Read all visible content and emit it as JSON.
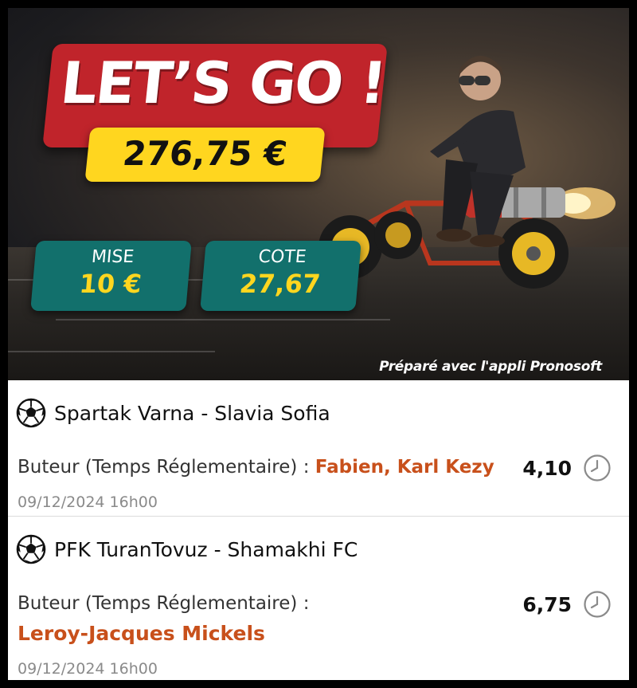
{
  "banner": {
    "title": "LET’S GO !",
    "potential_win": "276,75 €",
    "stake_label": "MISE",
    "stake_value": "10 €",
    "odds_label": "COTE",
    "odds_value": "27,67",
    "footer": "Préparé avec l'appli Pronosoft"
  },
  "bets": [
    {
      "match": "Spartak Varna - Slavia Sofia",
      "market": "Buteur (Temps Réglementaire) :",
      "selection": "Fabien, Karl Kezy",
      "odds": "4,10",
      "date": "09/12/2024 16h00",
      "icon": "soccer-ball-icon",
      "status_icon": "clock-icon"
    },
    {
      "match": "PFK TuranTovuz - Shamakhi FC",
      "market": "Buteur (Temps Réglementaire) :",
      "selection": "Leroy-Jacques Mickels",
      "odds": "6,75",
      "date": "09/12/2024 16h00",
      "icon": "soccer-ball-icon",
      "status_icon": "clock-icon"
    }
  ],
  "colors": {
    "title_red": "#c0242b",
    "amount_yellow": "#ffd61f",
    "stat_teal": "#12706c",
    "selection_orange": "#c8501b",
    "date_gray": "#8a8a8a"
  }
}
